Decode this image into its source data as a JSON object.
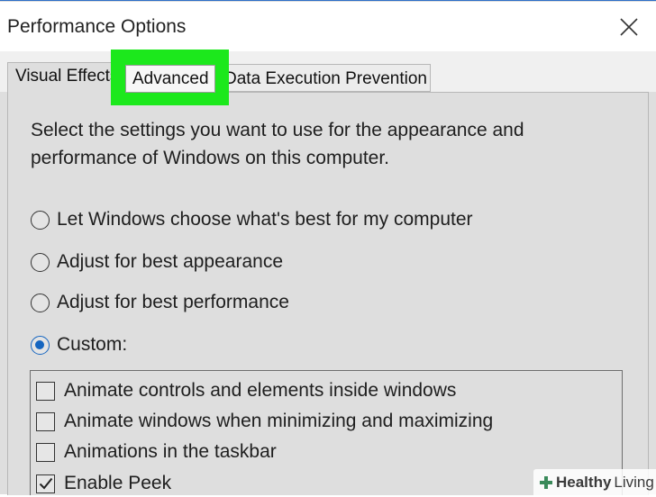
{
  "window": {
    "title": "Performance Options",
    "close_label": "Close",
    "accent_color": "#2e6fc7"
  },
  "tabs": {
    "visual_effects": "Visual Effects",
    "advanced": "Advanced",
    "dep": "Data Execution Prevention",
    "highlight_color": "#1ce81c"
  },
  "panel": {
    "description": "Select the settings you want to use for the appearance and performance of Windows on this computer.",
    "options": [
      {
        "label": "Let Windows choose what's best for my computer",
        "selected": false
      },
      {
        "label": "Adjust for best appearance",
        "selected": false
      },
      {
        "label": "Adjust for best performance",
        "selected": false
      },
      {
        "label": "Custom:",
        "selected": true
      }
    ],
    "effects": [
      {
        "label": "Animate controls and elements inside windows",
        "checked": false
      },
      {
        "label": "Animate windows when minimizing and maximizing",
        "checked": false
      },
      {
        "label": "Animations in the taskbar",
        "checked": false
      },
      {
        "label": "Enable Peek",
        "checked": true
      }
    ]
  },
  "watermark": {
    "brand": "Healthy",
    "suffix": "Living",
    "icon": "plus-icon"
  }
}
